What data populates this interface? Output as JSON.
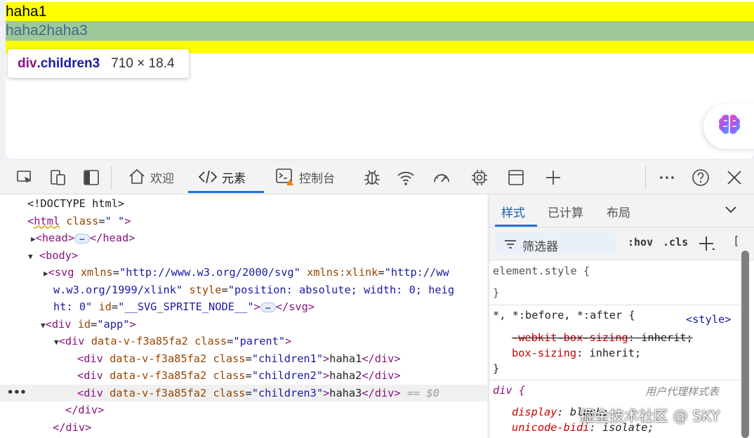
{
  "preview": {
    "children1_text": "haha1",
    "children23_text": "haha2haha3",
    "tooltip": {
      "tag": "div",
      "cls": ".children3",
      "dims": "710 × 18.4"
    },
    "colors": {
      "parent_bg": "#ffff00",
      "child_highlight": "#9fc89a"
    }
  },
  "toolbar": {
    "tabs": [
      {
        "label": "欢迎",
        "icon": "home-icon"
      },
      {
        "label": "元素",
        "icon": "code-icon",
        "active": true
      },
      {
        "label": "控制台",
        "icon": "console-icon"
      }
    ],
    "icons": [
      "inspect-icon",
      "device-toggle-icon",
      "dock-icon",
      "bug-icon",
      "wifi-icon",
      "performance-icon",
      "cpu-icon",
      "application-icon",
      "plus-icon",
      "more-icon",
      "help-icon",
      "close-icon"
    ]
  },
  "elements": {
    "l1": "<!DOCTYPE html>",
    "html_tag": "html",
    "html_attr": "class",
    "html_val": "\" \"",
    "head_tag": "head",
    "body_tag": "body",
    "svg": {
      "tag": "svg",
      "a1": "xmlns",
      "v1": "\"http://www.w3.org/2000/svg\"",
      "a2": "xmlns:xlink",
      "v2a": "\"http://ww",
      "v2b": "w.w3.org/1999/xlink\"",
      "a3": "style",
      "v3a": "\"position: absolute; width: 0; heig",
      "v3b": "ht: 0\"",
      "a4": "id",
      "v4": "\"__SVG_SPRITE_NODE__\""
    },
    "app": {
      "tag": "div",
      "attr": "id",
      "val": "\"app\""
    },
    "parent": {
      "tag": "div",
      "dv": "data-v-f3a85fa2",
      "attr": "class",
      "val": "\"parent\""
    },
    "child1": {
      "tag": "div",
      "dv": "data-v-f3a85fa2",
      "attr": "class",
      "val": "\"children1\"",
      "text": "haha1"
    },
    "child2": {
      "tag": "div",
      "dv": "data-v-f3a85fa2",
      "attr": "class",
      "val": "\"children2\"",
      "text": "haha2"
    },
    "child3": {
      "tag": "div",
      "dv": "data-v-f3a85fa2",
      "attr": "class",
      "val": "\"children3\"",
      "text": "haha3",
      "ref": "== $0"
    },
    "close_div1": "</div>",
    "close_div2": "</div>"
  },
  "styles": {
    "tabs": [
      "样式",
      "已计算",
      "布局"
    ],
    "filter_placeholder": "筛选器",
    "hov": ":hov",
    "cls": ".cls",
    "rules": {
      "element_style": "element.style {",
      "close": "}",
      "universal_sel": "*, *:before, *:after {",
      "universal_origin": "<style>",
      "p1_name": "-webkit-box-sizing",
      "p1_val": "inherit;",
      "p2_name": "box-sizing",
      "p2_val": "inherit;",
      "div_sel": "div {",
      "ua_label": "用户代理样式表",
      "p3_name": "display",
      "p3_val": "block;",
      "p4_name": "unicode-bidi",
      "p4_val": "isolate;"
    }
  },
  "watermark": "掘金技术社区 @ SKY"
}
